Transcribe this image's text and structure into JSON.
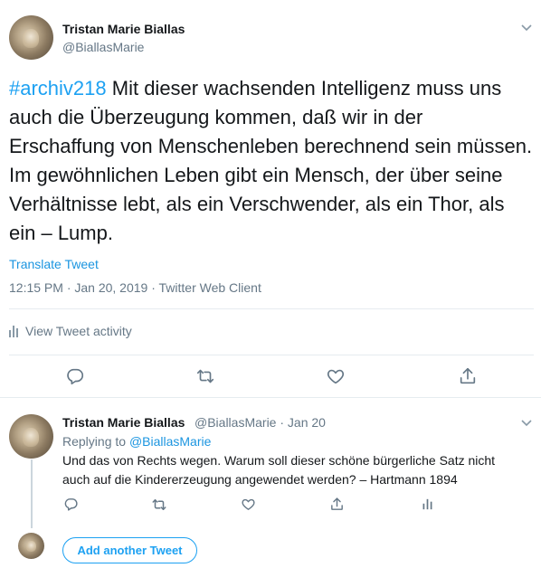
{
  "main_tweet": {
    "display_name": "Tristan Marie Biallas",
    "handle": "@BiallasMarie",
    "hashtag": "#archiv218",
    "text": " Mit dieser wachsenden Intelligenz muss uns auch die Überzeugung kommen, daß wir in der Erschaffung von Menschenleben berechnend sein müssen. Im gewöhnlichen Leben gibt ein Mensch, der über seine Verhältnisse lebt, als ein Verschwender, als ein Thor, als ein – Lump.",
    "translate_label": "Translate Tweet",
    "meta": "12:15 PM · Jan 20, 2019 · Twitter Web Client",
    "activity_label": "View Tweet activity"
  },
  "reply_tweet": {
    "display_name": "Tristan Marie Biallas",
    "handle_date": "@BiallasMarie · Jan 20",
    "replying_prefix": "Replying to ",
    "replying_handle": "@BiallasMarie",
    "text": "Und das von Rechts wegen. Warum soll dieser schöne bürgerliche Satz  nicht auch auf die Kindererzeugung angewendet werden? – Hartmann 1894"
  },
  "compose": {
    "add_another_label": "Add another Tweet"
  },
  "colors": {
    "accent": "#1da1f2",
    "link": "#1b95e0",
    "muted": "#657786",
    "icon": "#657786"
  },
  "icons": [
    "chevron-down-icon",
    "reply-icon",
    "retweet-icon",
    "like-icon",
    "share-icon",
    "analytics-icon"
  ]
}
